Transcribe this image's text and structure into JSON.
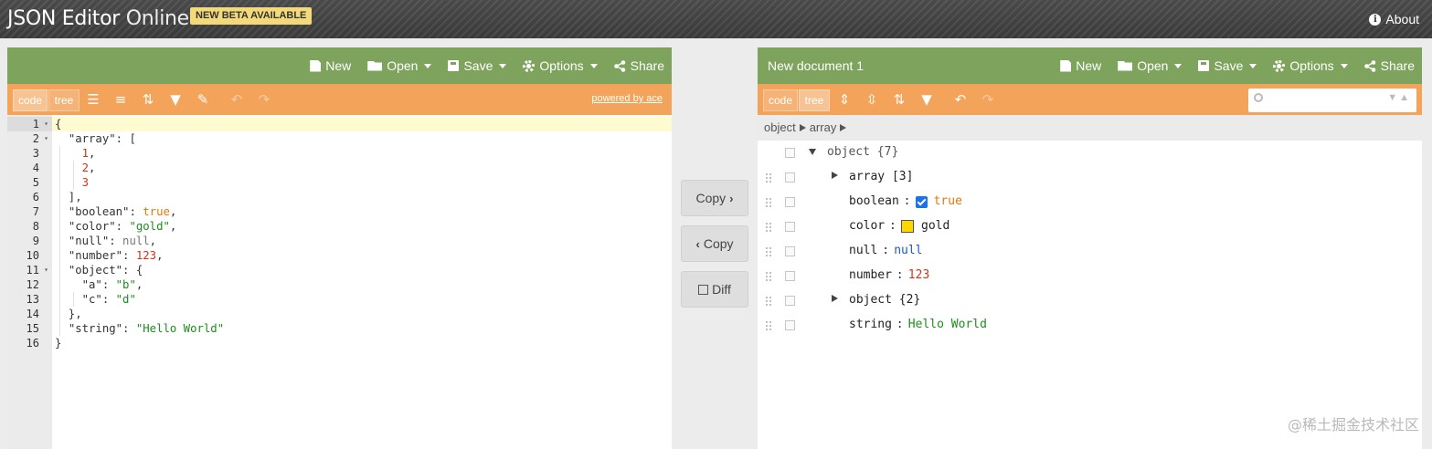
{
  "header": {
    "title_main": "JSON Editor",
    "title_sub": "Online",
    "beta": "NEW BETA AVAILABLE",
    "about": "About"
  },
  "left": {
    "menu": {
      "new": "New",
      "open": "Open",
      "save": "Save",
      "options": "Options",
      "share": "Share"
    },
    "mode_code": "code",
    "mode_tree": "tree",
    "powered": "powered by ace"
  },
  "right": {
    "title": "New document 1",
    "menu": {
      "new": "New",
      "open": "Open",
      "save": "Save",
      "options": "Options",
      "share": "Share"
    },
    "mode_code": "code",
    "mode_tree": "tree",
    "breadcrumb": [
      "object",
      "array"
    ]
  },
  "center": {
    "copy_right": "Copy",
    "copy_left": "Copy",
    "diff": "Diff"
  },
  "code_lines": [
    {
      "n": "1",
      "fold": true,
      "text": "{"
    },
    {
      "n": "2",
      "fold": true,
      "text": "  \"array\": ["
    },
    {
      "n": "3",
      "text": "    1,"
    },
    {
      "n": "4",
      "text": "    2,"
    },
    {
      "n": "5",
      "text": "    3"
    },
    {
      "n": "6",
      "text": "  ],"
    },
    {
      "n": "7",
      "text": "  \"boolean\": true,"
    },
    {
      "n": "8",
      "text": "  \"color\": \"gold\","
    },
    {
      "n": "9",
      "text": "  \"null\": null,"
    },
    {
      "n": "10",
      "text": "  \"number\": 123,"
    },
    {
      "n": "11",
      "fold": true,
      "text": "  \"object\": {"
    },
    {
      "n": "12",
      "text": "    \"a\": \"b\","
    },
    {
      "n": "13",
      "text": "    \"c\": \"d\""
    },
    {
      "n": "14",
      "text": "  },"
    },
    {
      "n": "15",
      "text": "  \"string\": \"Hello World\""
    },
    {
      "n": "16",
      "text": "}"
    }
  ],
  "tree": {
    "root": {
      "field": "object",
      "count": "{7}"
    },
    "rows": [
      {
        "field": "array",
        "count": "[3]",
        "kind": "array"
      },
      {
        "field": "boolean",
        "sep": ":",
        "value": "true",
        "kind": "boolean"
      },
      {
        "field": "color",
        "sep": ":",
        "value": "gold",
        "kind": "color",
        "swatch": "#ffd700"
      },
      {
        "field": "null",
        "sep": ":",
        "value": "null",
        "kind": "null"
      },
      {
        "field": "number",
        "sep": ":",
        "value": "123",
        "kind": "number"
      },
      {
        "field": "object",
        "count": "{2}",
        "kind": "object"
      },
      {
        "field": "string",
        "sep": ":",
        "value": "Hello World",
        "kind": "string"
      }
    ]
  },
  "colors": {
    "menubar": "#7da35c",
    "toolbar": "#f3a35a",
    "string": "#1a8f1a",
    "number": "#d0341d",
    "boolean": "#e0780f",
    "null": "#1d55c9"
  },
  "watermark": "@稀土掘金技术社区"
}
